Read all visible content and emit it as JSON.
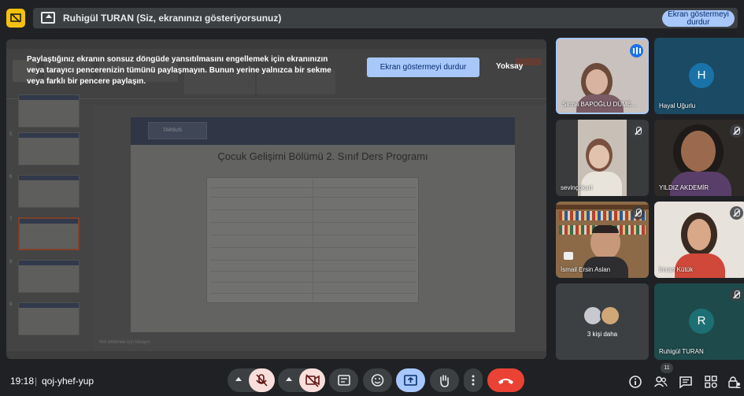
{
  "topbar": {
    "banner_text": "Ruhigül TURAN (Siz, ekranınızı gösteriyorsunuz)",
    "stop_button": "Ekran göstermeyi durdur"
  },
  "presentation": {
    "slide_title": "Çocuk Gelişimi Bölümü 2. Sınıf Ders Programı",
    "logo_text": "TARSUS",
    "notes_placeholder": "Not eklemek için tıklayın",
    "thumbnail_numbers": [
      "5",
      "6",
      "7",
      "8",
      "9",
      "10"
    ]
  },
  "notice": {
    "text": "Paylaştığınız ekranın sonsuz döngüde yansıtılmasını engellemek için ekranınızın veya tarayıcı pencerenizin tümünü paylaşmayın. Bunun yerine yalnızca bir sekme veya farklı bir pencere paylaşın.",
    "stop_button": "Ekran göstermeyi durdur",
    "dismiss": "Yoksay"
  },
  "participants": [
    {
      "name": "Sırma BAPOĞLU DÜME...",
      "speaking": true
    },
    {
      "name": "Hayal Uğurlu",
      "initial": "H",
      "color": "#1a73a8"
    },
    {
      "name": "sevinçokurt",
      "muted": true
    },
    {
      "name": "YILDIZ AKDEMİR",
      "muted": true
    },
    {
      "name": "İsmail Ersin Aslan",
      "muted": true
    },
    {
      "name": "İmran Kütük",
      "muted": true
    },
    {
      "name": "3 kişi daha"
    },
    {
      "name": "Ruhigül TURAN",
      "initial": "R",
      "color": "#1e6f73",
      "muted": true
    }
  ],
  "bottom": {
    "time": "19:18",
    "separator": "|",
    "meeting_code": "qoj-yhef-yup",
    "people_count": "11"
  },
  "colors": {
    "accent_blue": "#a8c7fa",
    "muted_red": "#f9dedc",
    "hangup_red": "#ea4335",
    "bg": "#202124"
  }
}
